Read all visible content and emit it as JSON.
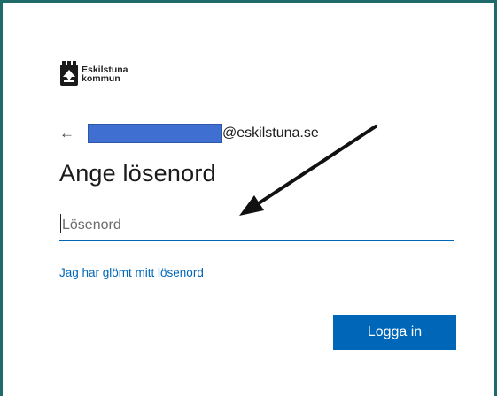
{
  "logo": {
    "line1": "Eskilstuna",
    "line2": "kommun"
  },
  "identity": {
    "back_icon": "←",
    "email_domain": "@eskilstuna.se"
  },
  "heading": "Ange lösenord",
  "password_field": {
    "placeholder": "Lösenord",
    "value": ""
  },
  "forgot_link": "Jag har glömt mitt lösenord",
  "signin_button": "Logga in",
  "colors": {
    "accent": "#0067b8",
    "redaction": "#3f6fd1",
    "frame_border": "#1f6b6b"
  }
}
